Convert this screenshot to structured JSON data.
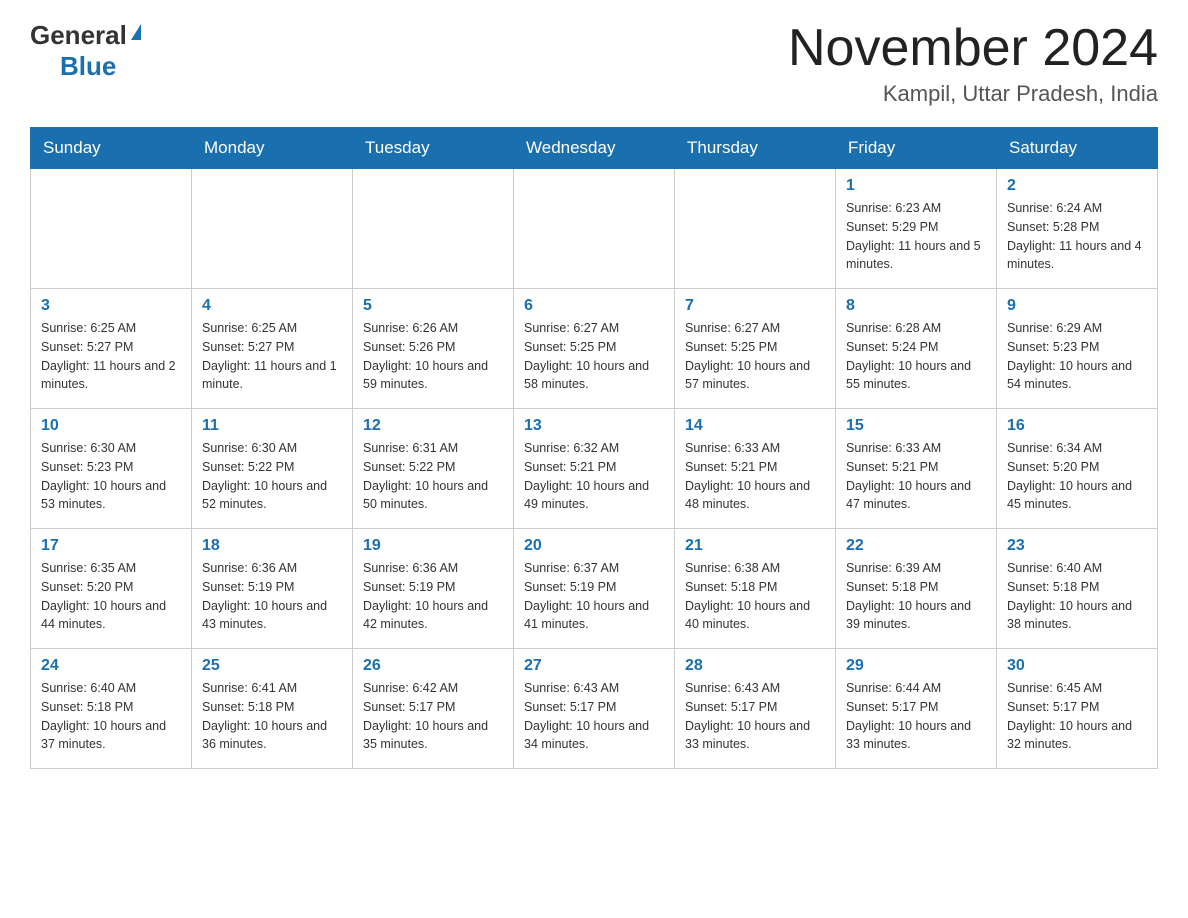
{
  "header": {
    "logo_general": "General",
    "logo_blue": "Blue",
    "month_title": "November 2024",
    "location": "Kampil, Uttar Pradesh, India"
  },
  "days_of_week": [
    "Sunday",
    "Monday",
    "Tuesday",
    "Wednesday",
    "Thursday",
    "Friday",
    "Saturday"
  ],
  "weeks": [
    [
      {
        "day": "",
        "info": ""
      },
      {
        "day": "",
        "info": ""
      },
      {
        "day": "",
        "info": ""
      },
      {
        "day": "",
        "info": ""
      },
      {
        "day": "",
        "info": ""
      },
      {
        "day": "1",
        "info": "Sunrise: 6:23 AM\nSunset: 5:29 PM\nDaylight: 11 hours and 5 minutes."
      },
      {
        "day": "2",
        "info": "Sunrise: 6:24 AM\nSunset: 5:28 PM\nDaylight: 11 hours and 4 minutes."
      }
    ],
    [
      {
        "day": "3",
        "info": "Sunrise: 6:25 AM\nSunset: 5:27 PM\nDaylight: 11 hours and 2 minutes."
      },
      {
        "day": "4",
        "info": "Sunrise: 6:25 AM\nSunset: 5:27 PM\nDaylight: 11 hours and 1 minute."
      },
      {
        "day": "5",
        "info": "Sunrise: 6:26 AM\nSunset: 5:26 PM\nDaylight: 10 hours and 59 minutes."
      },
      {
        "day": "6",
        "info": "Sunrise: 6:27 AM\nSunset: 5:25 PM\nDaylight: 10 hours and 58 minutes."
      },
      {
        "day": "7",
        "info": "Sunrise: 6:27 AM\nSunset: 5:25 PM\nDaylight: 10 hours and 57 minutes."
      },
      {
        "day": "8",
        "info": "Sunrise: 6:28 AM\nSunset: 5:24 PM\nDaylight: 10 hours and 55 minutes."
      },
      {
        "day": "9",
        "info": "Sunrise: 6:29 AM\nSunset: 5:23 PM\nDaylight: 10 hours and 54 minutes."
      }
    ],
    [
      {
        "day": "10",
        "info": "Sunrise: 6:30 AM\nSunset: 5:23 PM\nDaylight: 10 hours and 53 minutes."
      },
      {
        "day": "11",
        "info": "Sunrise: 6:30 AM\nSunset: 5:22 PM\nDaylight: 10 hours and 52 minutes."
      },
      {
        "day": "12",
        "info": "Sunrise: 6:31 AM\nSunset: 5:22 PM\nDaylight: 10 hours and 50 minutes."
      },
      {
        "day": "13",
        "info": "Sunrise: 6:32 AM\nSunset: 5:21 PM\nDaylight: 10 hours and 49 minutes."
      },
      {
        "day": "14",
        "info": "Sunrise: 6:33 AM\nSunset: 5:21 PM\nDaylight: 10 hours and 48 minutes."
      },
      {
        "day": "15",
        "info": "Sunrise: 6:33 AM\nSunset: 5:21 PM\nDaylight: 10 hours and 47 minutes."
      },
      {
        "day": "16",
        "info": "Sunrise: 6:34 AM\nSunset: 5:20 PM\nDaylight: 10 hours and 45 minutes."
      }
    ],
    [
      {
        "day": "17",
        "info": "Sunrise: 6:35 AM\nSunset: 5:20 PM\nDaylight: 10 hours and 44 minutes."
      },
      {
        "day": "18",
        "info": "Sunrise: 6:36 AM\nSunset: 5:19 PM\nDaylight: 10 hours and 43 minutes."
      },
      {
        "day": "19",
        "info": "Sunrise: 6:36 AM\nSunset: 5:19 PM\nDaylight: 10 hours and 42 minutes."
      },
      {
        "day": "20",
        "info": "Sunrise: 6:37 AM\nSunset: 5:19 PM\nDaylight: 10 hours and 41 minutes."
      },
      {
        "day": "21",
        "info": "Sunrise: 6:38 AM\nSunset: 5:18 PM\nDaylight: 10 hours and 40 minutes."
      },
      {
        "day": "22",
        "info": "Sunrise: 6:39 AM\nSunset: 5:18 PM\nDaylight: 10 hours and 39 minutes."
      },
      {
        "day": "23",
        "info": "Sunrise: 6:40 AM\nSunset: 5:18 PM\nDaylight: 10 hours and 38 minutes."
      }
    ],
    [
      {
        "day": "24",
        "info": "Sunrise: 6:40 AM\nSunset: 5:18 PM\nDaylight: 10 hours and 37 minutes."
      },
      {
        "day": "25",
        "info": "Sunrise: 6:41 AM\nSunset: 5:18 PM\nDaylight: 10 hours and 36 minutes."
      },
      {
        "day": "26",
        "info": "Sunrise: 6:42 AM\nSunset: 5:17 PM\nDaylight: 10 hours and 35 minutes."
      },
      {
        "day": "27",
        "info": "Sunrise: 6:43 AM\nSunset: 5:17 PM\nDaylight: 10 hours and 34 minutes."
      },
      {
        "day": "28",
        "info": "Sunrise: 6:43 AM\nSunset: 5:17 PM\nDaylight: 10 hours and 33 minutes."
      },
      {
        "day": "29",
        "info": "Sunrise: 6:44 AM\nSunset: 5:17 PM\nDaylight: 10 hours and 33 minutes."
      },
      {
        "day": "30",
        "info": "Sunrise: 6:45 AM\nSunset: 5:17 PM\nDaylight: 10 hours and 32 minutes."
      }
    ]
  ]
}
